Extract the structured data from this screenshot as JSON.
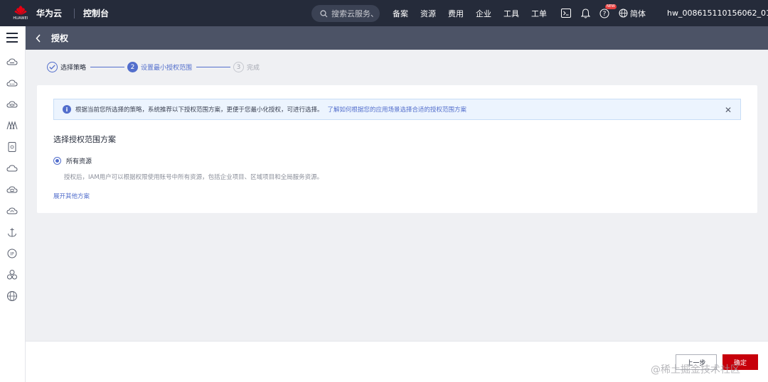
{
  "topbar": {
    "logo_text": "HUAWEI",
    "brand": "华为云",
    "console": "控制台",
    "search_placeholder": "搜索云服务、",
    "nav": [
      "备案",
      "资源",
      "费用",
      "企业",
      "工具",
      "工单"
    ],
    "new_badge": "NEW",
    "language": "简体",
    "username": "hw_008615110156062_01"
  },
  "sidebar": {
    "icons": [
      "cloud-server-icon",
      "cloud-icon",
      "cloud-database-icon",
      "network-icon",
      "storage-icon",
      "cloud-outline-icon",
      "cloud-container-icon",
      "cloud-refresh-icon",
      "anchor-icon",
      "ip-icon",
      "cluster-icon",
      "globe-icon"
    ]
  },
  "page": {
    "title": "授权"
  },
  "steps": [
    {
      "label": "选择策略",
      "status": "done"
    },
    {
      "number": "2",
      "label": "设置最小授权范围",
      "status": "active"
    },
    {
      "number": "3",
      "label": "完成",
      "status": "todo"
    }
  ],
  "notice": {
    "text": "根据当前您所选择的策略，系统推荐以下授权范围方案，更便于您最小化授权，可进行选择。",
    "link": "了解如何根据您的应用场景选择合适的授权范围方案",
    "close": "✕"
  },
  "scope": {
    "section_title": "选择授权范围方案",
    "option_label": "所有资源",
    "option_desc": "授权后，IAM用户可以根据权限使用账号中所有资源，包括企业项目、区域项目和全局服务资源。",
    "expand_link": "展开其他方案"
  },
  "footer": {
    "prev_button": "上一步",
    "confirm_button": "确定"
  },
  "watermark": "@稀土掘金技术社区",
  "colors": {
    "topbar": "#252b3a",
    "header": "#4c5366",
    "accent": "#526ecc",
    "confirm": "#c7000b"
  }
}
